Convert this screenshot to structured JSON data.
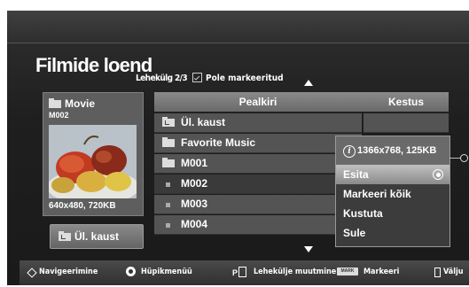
{
  "title": "Filmide loend",
  "page_indicator": "Lehekülg 2/3",
  "unmarked_label": "Pole markeeritud",
  "preview": {
    "folder": "Movie",
    "file_id": "M002",
    "resolution_size": "640x480, 720KB"
  },
  "up_folder_button": "Ül. kaust",
  "table": {
    "headers": [
      "Pealkiri",
      "Kestus"
    ],
    "rows": [
      {
        "label": "Ül. kaust",
        "kind": "up-folder"
      },
      {
        "label": "Favorite Music",
        "kind": "folder"
      },
      {
        "label": "M001",
        "kind": "folder"
      },
      {
        "label": "M002",
        "kind": "file",
        "selected": true
      },
      {
        "label": "M003",
        "kind": "file"
      },
      {
        "label": "M004",
        "kind": "file"
      }
    ]
  },
  "popup": {
    "info": "1366x768, 125KB",
    "info_icon": "i",
    "items": [
      "Esita",
      "Markeeri kõik",
      "Kustuta",
      "Sule"
    ],
    "highlighted_item": "Esita"
  },
  "bottom_bar": {
    "navigate": "Navigeerimine",
    "popup_menu": "Hüpikmenüü",
    "page_key": "P",
    "page_change": "Lehekülje muutmine",
    "mark_key": "MARK",
    "mark": "Markeeri",
    "exit": "Välju"
  },
  "colors": {
    "background": "#1f1f1f",
    "highlight": "#a8a8a8",
    "panel": "#545454"
  }
}
